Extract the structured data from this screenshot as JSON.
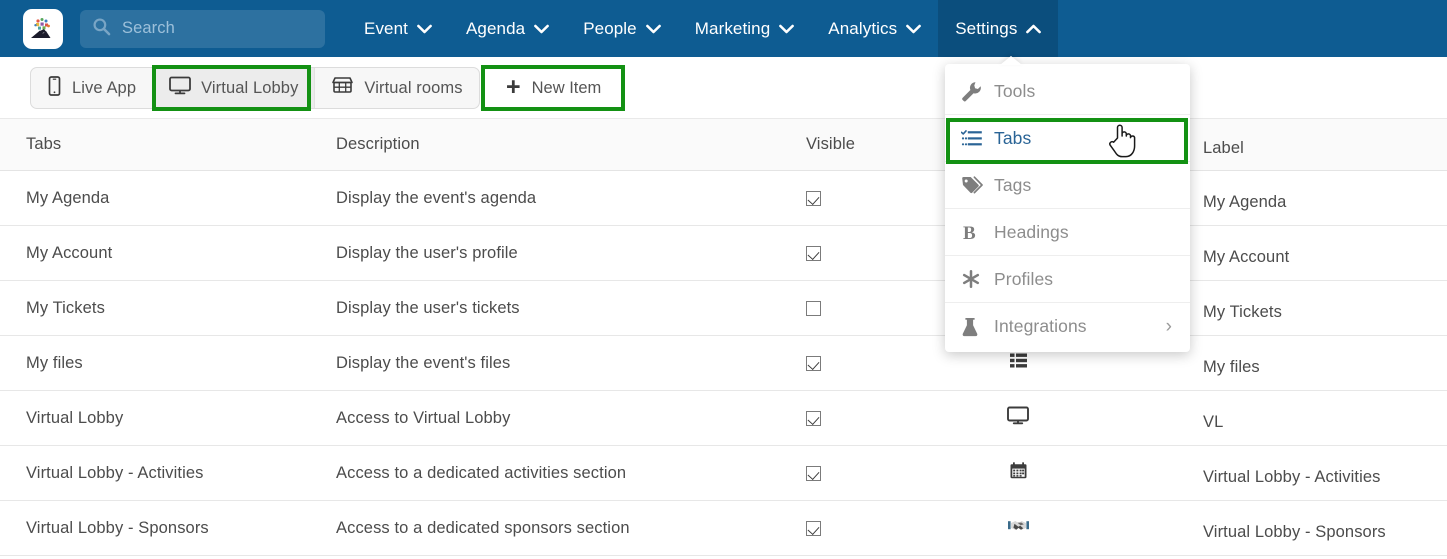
{
  "brand": {
    "logo_name": "app-logo",
    "nav_bg": "#0e5c92",
    "nav_active_bg": "#0b4e7d",
    "highlight": "#139113"
  },
  "search": {
    "placeholder": "Search",
    "value": "",
    "icon": "search-icon"
  },
  "topnav": {
    "items": [
      {
        "label": "Event",
        "icon": "chevron-down-icon",
        "active": false
      },
      {
        "label": "Agenda",
        "icon": "chevron-down-icon",
        "active": false
      },
      {
        "label": "People",
        "icon": "chevron-down-icon",
        "active": false
      },
      {
        "label": "Marketing",
        "icon": "chevron-down-icon",
        "active": false
      },
      {
        "label": "Analytics",
        "icon": "chevron-down-icon",
        "active": false
      },
      {
        "label": "Settings",
        "icon": "chevron-up-icon",
        "active": true
      }
    ]
  },
  "dropdown": {
    "open_for": "Settings",
    "items": [
      {
        "label": "Tools",
        "icon": "wrench-icon",
        "highlighted": false,
        "submenu": false
      },
      {
        "label": "Tabs",
        "icon": "list-tasks-icon",
        "highlighted": true,
        "submenu": false
      },
      {
        "label": "Tags",
        "icon": "tag-icon",
        "highlighted": false,
        "submenu": false
      },
      {
        "label": "Headings",
        "icon": "bold-b-icon",
        "highlighted": false,
        "submenu": false
      },
      {
        "label": "Profiles",
        "icon": "asterisk-icon",
        "highlighted": false,
        "submenu": false
      },
      {
        "label": "Integrations",
        "icon": "flask-icon",
        "highlighted": false,
        "submenu": true,
        "chevron": "›"
      }
    ]
  },
  "subbar": {
    "segments": [
      {
        "label": "Live App",
        "icon": "mobile-phone-icon",
        "selected": false,
        "annotated": false
      },
      {
        "label": "Virtual Lobby",
        "icon": "monitor-icon",
        "selected": true,
        "annotated": true
      },
      {
        "label": "Virtual rooms",
        "icon": "store-icon",
        "selected": false,
        "annotated": false
      }
    ],
    "new_item": {
      "label": "New Item",
      "icon": "plus-icon",
      "annotated": true
    }
  },
  "table": {
    "headers": [
      "Tabs",
      "Description",
      "Visible",
      "",
      "Label"
    ],
    "rows": [
      {
        "tab": "My Agenda",
        "description": "Display the event's agenda",
        "visible": true,
        "icon": "",
        "label": "My Agenda"
      },
      {
        "tab": "My Account",
        "description": "Display the user's profile",
        "visible": true,
        "icon": "",
        "label": "My Account"
      },
      {
        "tab": "My Tickets",
        "description": "Display the user's tickets",
        "visible": false,
        "icon": "",
        "label": "My Tickets"
      },
      {
        "tab": "My files",
        "description": "Display the event's files",
        "visible": true,
        "icon": "list-blocks-icon",
        "label": "My files"
      },
      {
        "tab": "Virtual Lobby",
        "description": "Access to Virtual Lobby",
        "visible": true,
        "icon": "monitor-icon",
        "label": "VL"
      },
      {
        "tab": "Virtual Lobby - Activities",
        "description": "Access to a dedicated activities section",
        "visible": true,
        "icon": "calendar-icon",
        "label": "Virtual Lobby - Activities"
      },
      {
        "tab": "Virtual Lobby - Sponsors",
        "description": "Access to a dedicated sponsors section",
        "visible": true,
        "icon": "handshake-icon",
        "label": "Virtual Lobby - Sponsors"
      }
    ]
  },
  "cursor": {
    "type": "pointer-hand-cursor"
  }
}
